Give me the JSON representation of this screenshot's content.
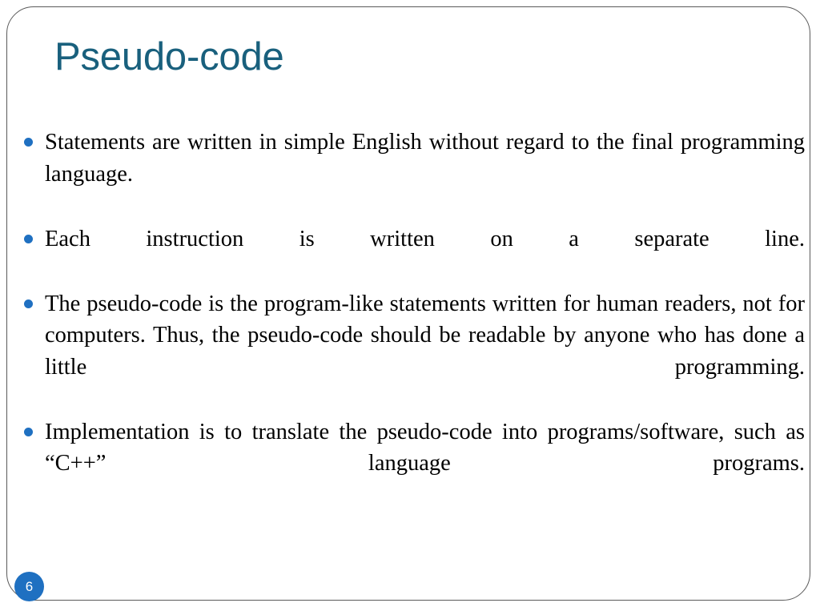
{
  "slide": {
    "title": "Pseudo-code",
    "page_number": "6",
    "title_color": "#19607D",
    "bullet_color": "#1F70C1",
    "badge_color": "#1F70C1",
    "text_color": "#000000",
    "frame_color": "#5A5A5A",
    "background_color": "#FFFFFF"
  },
  "bullets": [
    {
      "text": "Statements are written in simple English without regard to the final programming language."
    },
    {
      "text": "Each instruction is written on a separate line."
    },
    {
      "text": "The pseudo-code is the program-like statements written for human readers, not for computers. Thus, the pseudo-code should be readable by anyone who has done a little programming."
    },
    {
      "text": "Implementation is to translate the pseudo-code into programs/software, such as “C++” language programs."
    }
  ]
}
